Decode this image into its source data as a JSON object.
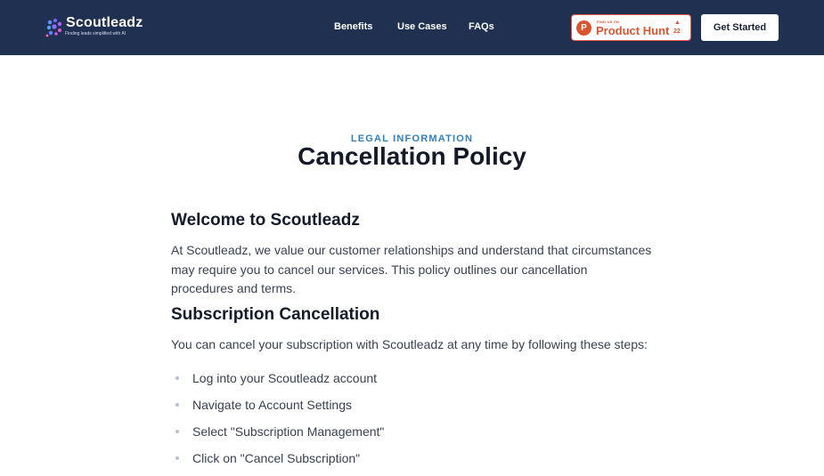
{
  "header": {
    "logo": {
      "name": "Scoutleadz",
      "tagline": "Finding leads simplified with AI"
    },
    "nav": [
      {
        "label": "Benefits"
      },
      {
        "label": "Use Cases"
      },
      {
        "label": "FAQs"
      }
    ],
    "product_hunt": {
      "small_text": "FIND US ON",
      "name": "Product Hunt",
      "upvotes": "22",
      "letter": "P"
    },
    "cta_label": "Get Started"
  },
  "hero": {
    "eyebrow": "LEGAL INFORMATION",
    "title": "Cancellation Policy"
  },
  "sections": {
    "welcome": {
      "heading": "Welcome to Scoutleadz",
      "body": "At Scoutleadz, we value our customer relationships and understand that circumstances may require you to cancel our services. This policy outlines our cancellation procedures and terms."
    },
    "subscription": {
      "heading": "Subscription Cancellation",
      "body": "You can cancel your subscription with Scoutleadz at any time by following these steps:",
      "steps": [
        "Log into your Scoutleadz account",
        "Navigate to Account Settings",
        "Select \"Subscription Management\"",
        "Click on \"Cancel Subscription\""
      ]
    }
  },
  "colors": {
    "header_bg": "#1f3050",
    "accent": "#2f7fbf",
    "product_hunt": "#da552f"
  }
}
